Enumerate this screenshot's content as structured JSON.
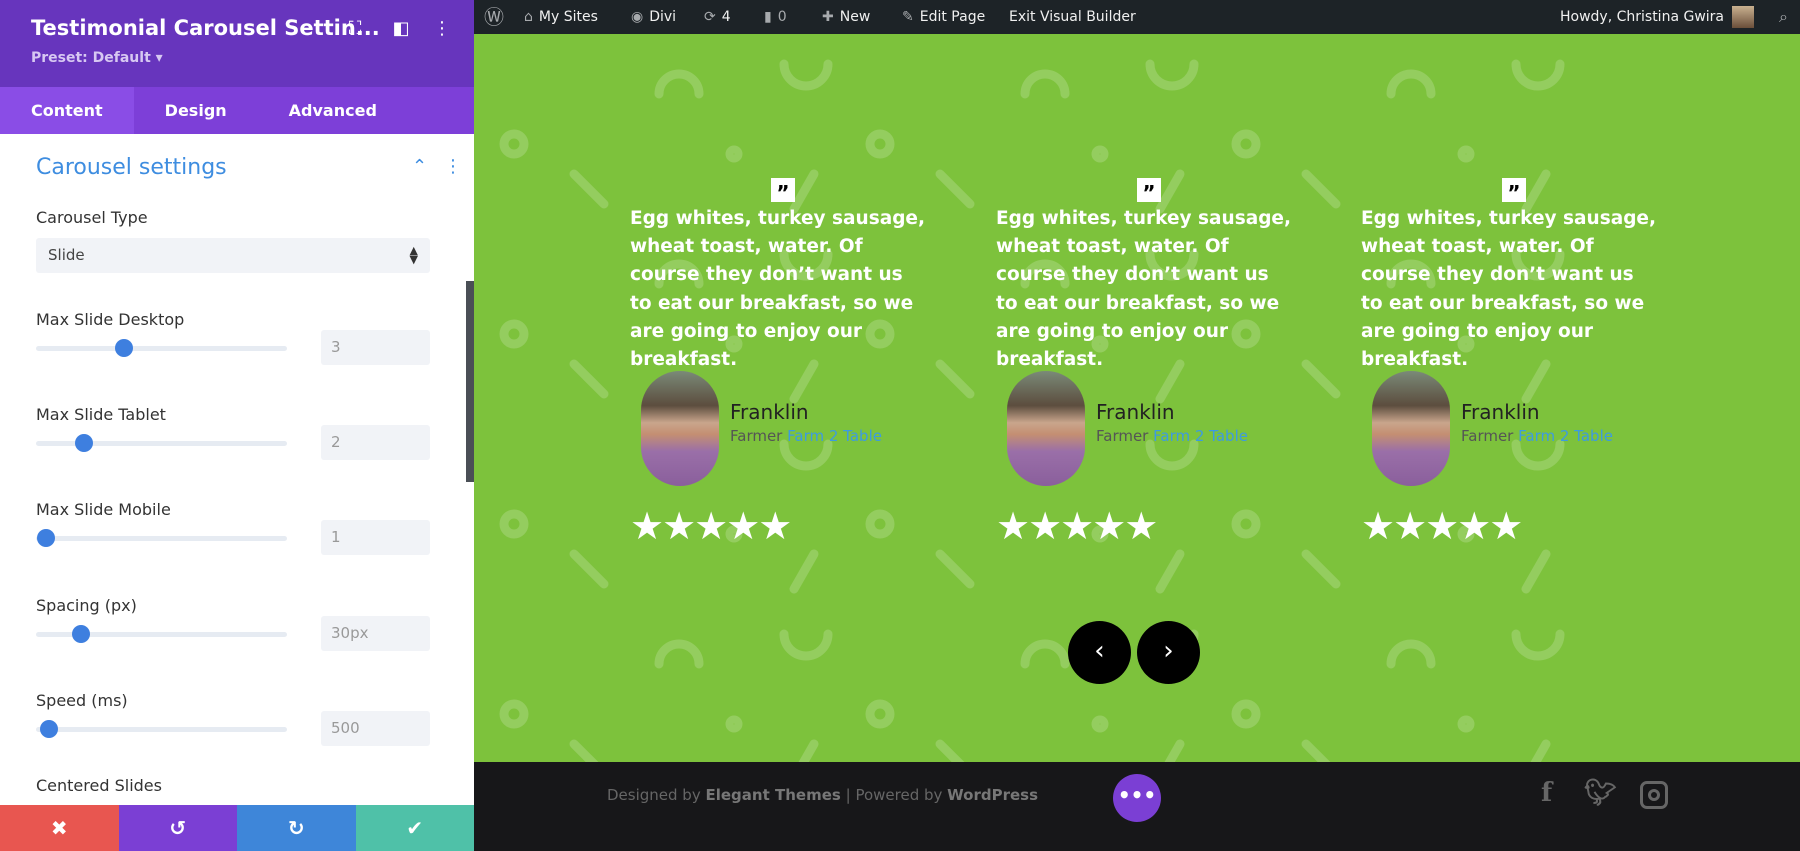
{
  "panel": {
    "title": "Testimonial Carousel Settin...",
    "preset": "Preset: Default ▾",
    "tabs": [
      {
        "label": "Content",
        "active": true
      },
      {
        "label": "Design"
      },
      {
        "label": "Advanced"
      }
    ],
    "section_title": "Carousel settings",
    "carousel_type": {
      "label": "Carousel Type",
      "value": "Slide"
    },
    "sliders": [
      {
        "label": "Max Slide Desktop",
        "value": "3",
        "fraction": 0.35
      },
      {
        "label": "Max Slide Tablet",
        "value": "2",
        "fraction": 0.19
      },
      {
        "label": "Max Slide Mobile",
        "value": "1",
        "fraction": 0.04
      },
      {
        "label": "Spacing (px)",
        "value": "30px",
        "fraction": 0.18
      },
      {
        "label": "Speed (ms)",
        "value": "500",
        "fraction": 0.05
      }
    ],
    "next_label": "Centered Slides",
    "buttons": {
      "cancel": "✖",
      "undo": "↺",
      "redo": "↻",
      "save": "✔"
    },
    "colors": {
      "header": "#6735bd",
      "accent": "#3e8de0",
      "cancel": "#e85650",
      "undo": "#7b3fd4",
      "redo": "#3e86d9",
      "save": "#4fc1a8"
    }
  },
  "adminbar": {
    "my_sites": "My Sites",
    "divi": "Divi",
    "updates": "4",
    "comments": "0",
    "new": "New",
    "edit_page": "Edit Page",
    "exit": "Exit Visual Builder",
    "howdy": "Howdy, Christina Gwira"
  },
  "testimonials": [
    {
      "quote": "Egg whites, turkey sausage, wheat toast, water. Of course they don’t want us to eat our breakfast, so we are going to enjoy our breakfast.",
      "name": "Franklin",
      "role": "Farmer",
      "company": "Farm 2 Table",
      "rating": 5,
      "stars": "★★★★★"
    },
    {
      "quote": "Egg whites, turkey sausage, wheat toast, water. Of course they don’t want us to eat our breakfast, so we are going to enjoy our breakfast.",
      "name": "Franklin",
      "role": "Farmer",
      "company": "Farm 2 Table",
      "rating": 5,
      "stars": "★★★★★"
    },
    {
      "quote": "Egg whites, turkey sausage, wheat toast, water. Of course they don’t want us to eat our breakfast, so we are going to enjoy our breakfast.",
      "name": "Franklin",
      "role": "Farmer",
      "company": "Farm 2 Table",
      "rating": 5,
      "stars": "★★★★★"
    }
  ],
  "footer": {
    "designed_by": "Designed by",
    "elegant": "Elegant Themes",
    "sep": "|",
    "powered_by": "Powered by",
    "wordpress": "WordPress"
  },
  "colors": {
    "background": "#7dc23c",
    "footer": "#171719"
  }
}
